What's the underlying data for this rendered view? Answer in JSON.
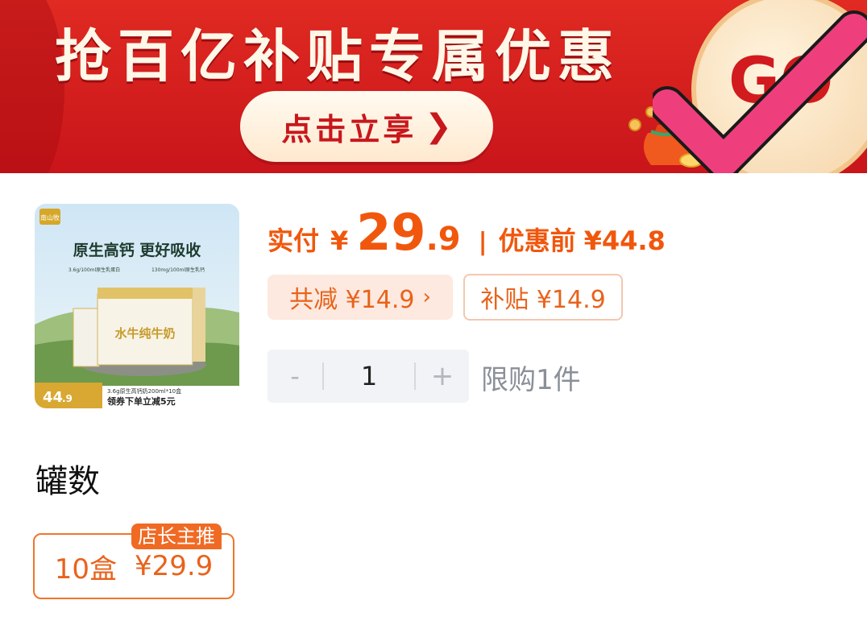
{
  "banner": {
    "title": "抢百亿补贴专属优惠",
    "button_label": "点击立享",
    "button_chevron": "❯",
    "go_text": "GO",
    "money_bag_icon": "money-bag-icon",
    "checkmark_icon": "checkmark-icon"
  },
  "product": {
    "thumbnail": {
      "brand": "南山牧",
      "headline": "原生高钙 更好吸收",
      "sub_left": "3.6g/100ml原生乳蛋白",
      "sub_right": "130mg/100ml原生乳钙",
      "box_label": "水牛纯牛奶",
      "price_integer": "44",
      "price_decimal": ".9",
      "spec_line": "3.6g原生高钙奶200ml*10盒",
      "promo_line": "领券下单立减5元"
    },
    "pay_label": "实付",
    "currency": "¥",
    "pay_integer": "29",
    "pay_decimal": ".9",
    "separator": "|",
    "before_label": "优惠前",
    "before_value": "¥44.8",
    "reduction_label": "共减 ¥14.9",
    "reduction_chevron": "›",
    "subsidy_label": "补贴 ¥14.9",
    "quantity": "1",
    "minus_symbol": "-",
    "plus_symbol": "+",
    "limit_text": "限购1件"
  },
  "spec": {
    "section_title": "罐数",
    "options": [
      {
        "quantity": "10盒",
        "price": "¥29.9",
        "badge": "店长主推",
        "selected": true
      }
    ]
  },
  "colors": {
    "accent": "#f0570d",
    "banner_red": "#d61c1f",
    "checkmark": "#ee3f7c"
  }
}
